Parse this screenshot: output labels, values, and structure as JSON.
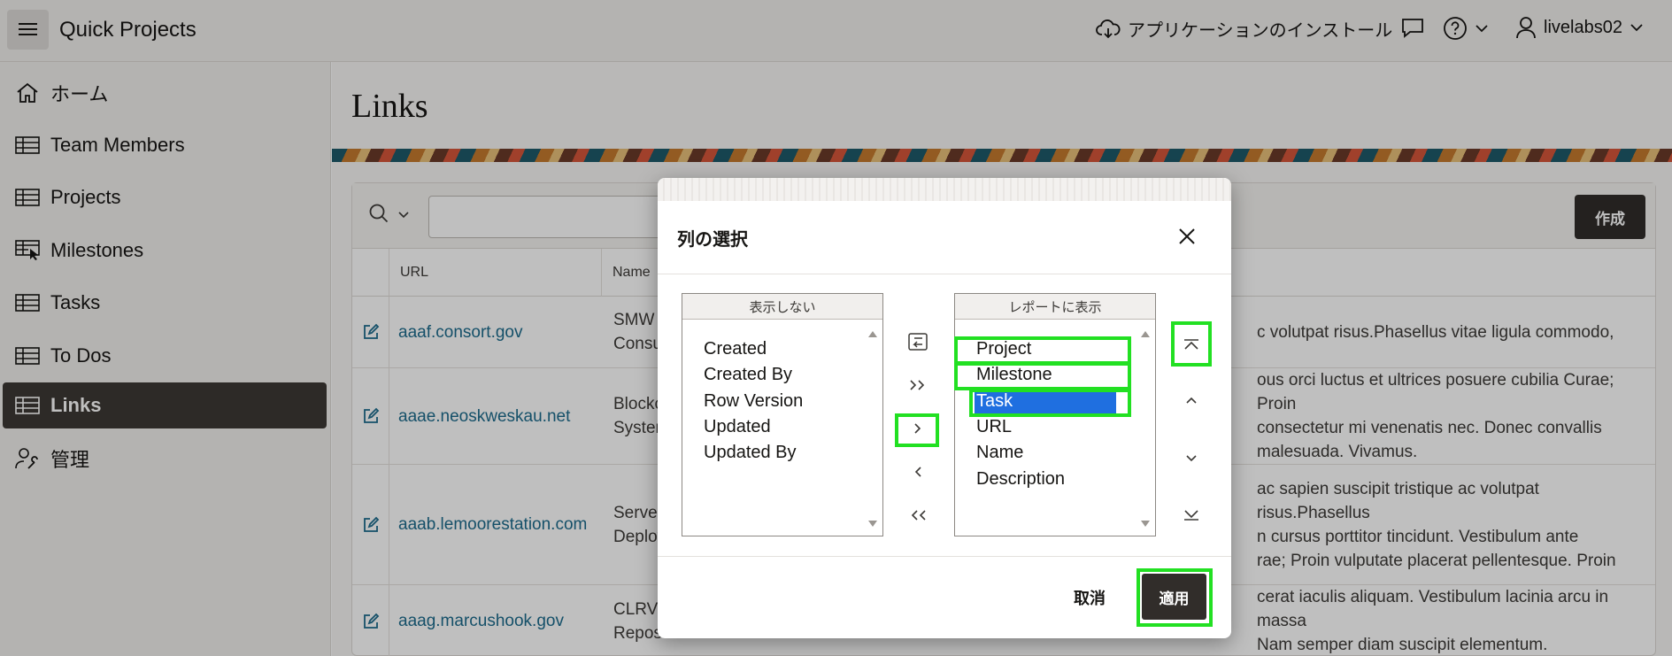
{
  "header": {
    "app_title": "Quick Projects",
    "install_label": "アプリケーションのインストール",
    "user_name": "livelabs02"
  },
  "sidebar": {
    "items": [
      {
        "label": "ホーム",
        "icon": "home-icon"
      },
      {
        "label": "Team Members",
        "icon": "table-icon"
      },
      {
        "label": "Projects",
        "icon": "table-icon"
      },
      {
        "label": "Milestones",
        "icon": "table-pointer-icon"
      },
      {
        "label": "Tasks",
        "icon": "table-icon"
      },
      {
        "label": "To Dos",
        "icon": "table-icon"
      },
      {
        "label": "Links",
        "icon": "table-icon",
        "active": true
      },
      {
        "label": "管理",
        "icon": "user-wrench-icon"
      }
    ]
  },
  "main": {
    "page_title": "Links",
    "create_label": "作成",
    "columns": [
      "URL",
      "Name"
    ],
    "rows": [
      {
        "url": "aaaf.consort.gov",
        "name": "SMW\nConsu",
        "desc": "c volutpat risus.Phasellus vitae ligula commodo,"
      },
      {
        "url": "aaae.neoskweskau.net",
        "name": "Blockc\nSysten",
        "desc": "ous orci luctus et ultrices posuere cubilia Curae; Proin\nconsectetur mi venenatis nec. Donec convallis\nmalesuada. Vivamus."
      },
      {
        "url": "aaab.lemoorestation.com",
        "name": "Server\nDeploy",
        "desc": "ac sapien suscipit tristique ac volutpat risus.Phasellus\nn cursus porttitor tincidunt. Vestibulum ante\nrae; Proin vulputate placerat pellentesque. Proin"
      },
      {
        "url": "aaag.marcushook.gov",
        "name": "CLRV\nReposi",
        "desc": "cerat iaculis aliquam. Vestibulum lacinia arcu in massa\nNam semper diam suscipit elementum."
      }
    ]
  },
  "dialog": {
    "title": "列の選択",
    "left_header": "表示しない",
    "right_header": "レポートに表示",
    "hidden_columns": [
      "Created",
      "Created By",
      "Row Version",
      "Updated",
      "Updated By"
    ],
    "shown_columns": [
      "Project",
      "Milestone",
      "Task",
      "URL",
      "Name",
      "Description"
    ],
    "selected_column": "Task",
    "cancel_label": "取消",
    "apply_label": "適用",
    "highlight_color": "#22e022"
  }
}
